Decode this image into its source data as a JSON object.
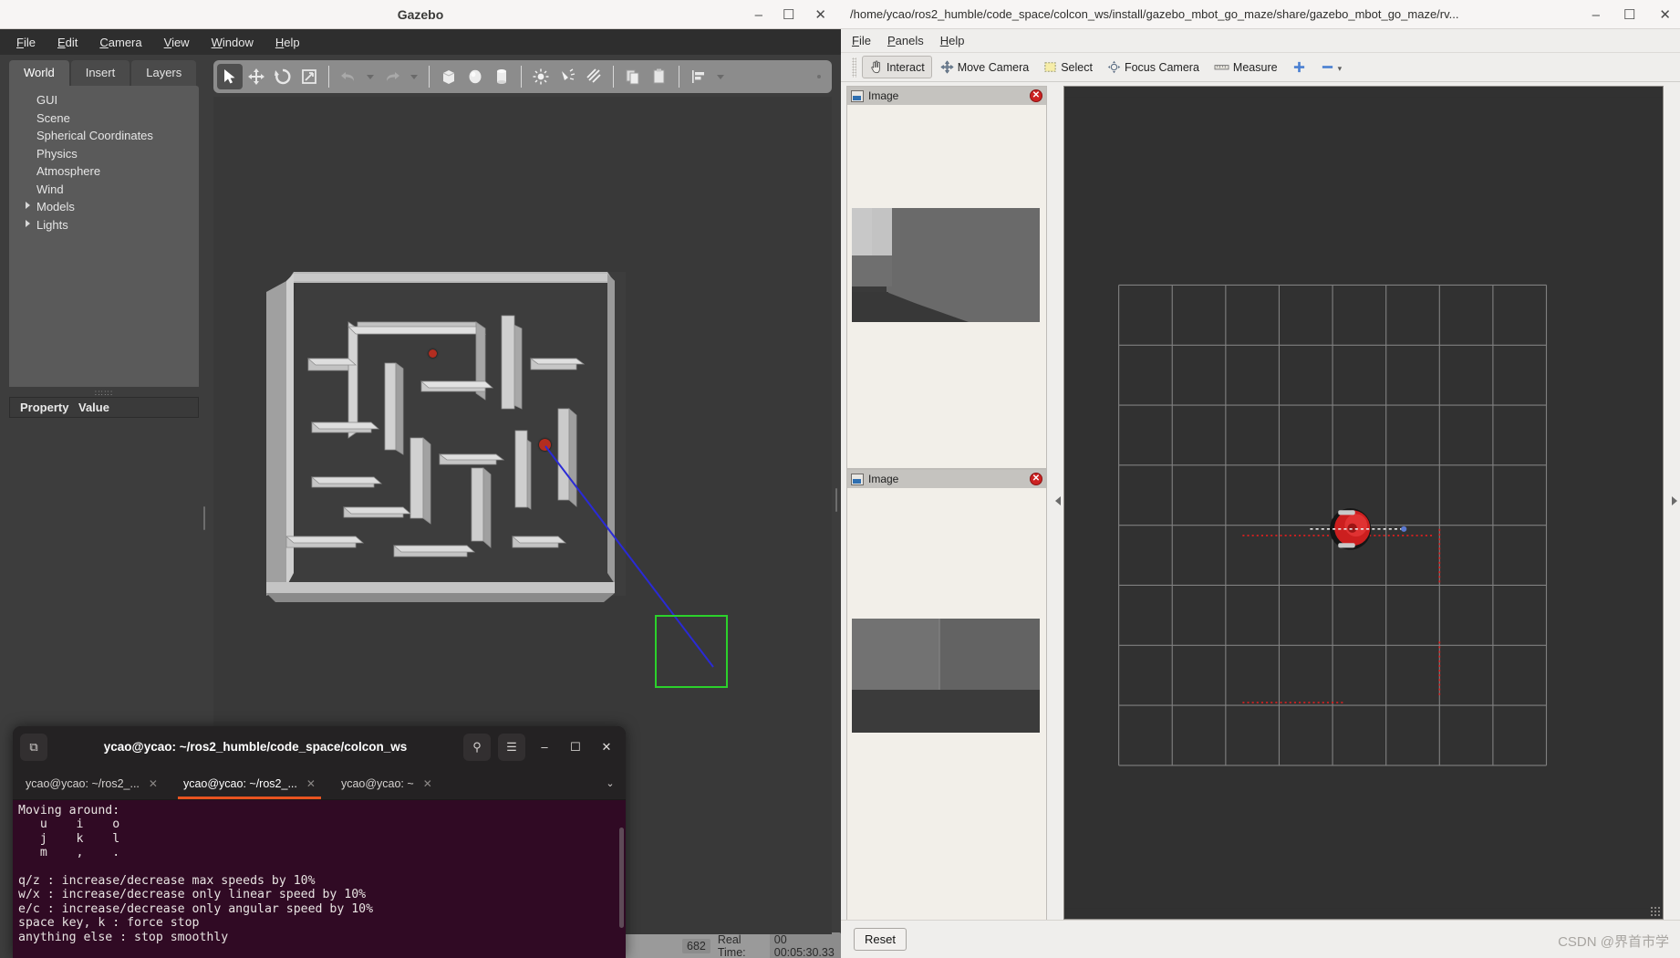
{
  "gazebo": {
    "window_title": "Gazebo",
    "window_buttons": [
      "–",
      "☐",
      "✕"
    ],
    "menus": [
      "File",
      "Edit",
      "Camera",
      "View",
      "Window",
      "Help"
    ],
    "tabs": [
      "World",
      "Insert",
      "Layers"
    ],
    "active_tab": "World",
    "tree_items": [
      {
        "label": "GUI",
        "expandable": false
      },
      {
        "label": "Scene",
        "expandable": false
      },
      {
        "label": "Spherical Coordinates",
        "expandable": false
      },
      {
        "label": "Physics",
        "expandable": false
      },
      {
        "label": "Atmosphere",
        "expandable": false
      },
      {
        "label": "Wind",
        "expandable": false
      },
      {
        "label": "Models",
        "expandable": true
      },
      {
        "label": "Lights",
        "expandable": true
      }
    ],
    "property_table": {
      "col_property": "Property",
      "col_value": "Value",
      "rows": []
    },
    "toolbar_icons": [
      "select-arrow-icon",
      "translate-icon",
      "rotate-icon",
      "scale-icon",
      "undo-icon",
      "redo-icon",
      "box-icon",
      "sphere-icon",
      "cylinder-icon",
      "point-light-icon",
      "spot-light-icon",
      "directional-light-icon",
      "copy-icon",
      "paste-icon",
      "align-icon"
    ],
    "status": {
      "sim_time_partial": "682",
      "real_time_label": "Real Time:",
      "real_time_value": "00 00:05:30.33"
    }
  },
  "rviz": {
    "window_title": "/home/ycao/ros2_humble/code_space/colcon_ws/install/gazebo_mbot_go_maze/share/gazebo_mbot_go_maze/rv...",
    "window_buttons": [
      "–",
      "☐",
      "✕"
    ],
    "menus": [
      "File",
      "Panels",
      "Help"
    ],
    "toolbar": [
      {
        "label": "Interact",
        "icon": "hand-cursor-icon",
        "active": true
      },
      {
        "label": "Move Camera",
        "icon": "move-camera-icon",
        "active": false
      },
      {
        "label": "Select",
        "icon": "select-rect-icon",
        "active": false
      },
      {
        "label": "Focus Camera",
        "icon": "focus-camera-icon",
        "active": false
      },
      {
        "label": "Measure",
        "icon": "measure-ruler-icon",
        "active": false
      },
      {
        "label": "",
        "icon": "plus-icon",
        "active": false
      },
      {
        "label": "",
        "icon": "minus-icon",
        "active": false
      }
    ],
    "panels": [
      {
        "title": "Image",
        "close": "✕"
      },
      {
        "title": "Image",
        "close": "✕"
      }
    ],
    "bottom": {
      "reset_label": "Reset"
    },
    "watermark": "CSDN @界首市学"
  },
  "terminal": {
    "title": "ycao@ycao: ~/ros2_humble/code_space/colcon_ws",
    "header_buttons": [
      {
        "name": "new-tab-button",
        "glyph": "⧉"
      },
      {
        "name": "search-button",
        "glyph": "⚲"
      },
      {
        "name": "hamburger-menu-button",
        "glyph": "☰"
      },
      {
        "name": "minimize-button",
        "glyph": "–"
      },
      {
        "name": "maximize-button",
        "glyph": "☐"
      },
      {
        "name": "close-button",
        "glyph": "✕"
      }
    ],
    "tabs": [
      {
        "label": "ycao@ycao: ~/ros2_...",
        "active": false,
        "close": "✕"
      },
      {
        "label": "ycao@ycao: ~/ros2_...",
        "active": true,
        "close": "✕"
      },
      {
        "label": "ycao@ycao: ~",
        "active": false,
        "close": "✕"
      }
    ],
    "tab_list_caret": "⌄",
    "lines": [
      "Moving around:",
      "   u    i    o",
      "   j    k    l",
      "   m    ,    .",
      "",
      "q/z : increase/decrease max speeds by 10%",
      "w/x : increase/decrease only linear speed by 10%",
      "e/c : increase/decrease only angular speed by 10%",
      "space key, k : force stop",
      "anything else : stop smoothly"
    ]
  },
  "colors": {
    "ubuntu_accent": "#e95420",
    "terminal_bg": "#300a24",
    "gazebo_panel": "#3d3d3d",
    "rviz_bg": "#efeeec",
    "robot_red": "#cc2020",
    "goal_green": "#2bd12b",
    "laser_blue": "#2a2ad6"
  }
}
